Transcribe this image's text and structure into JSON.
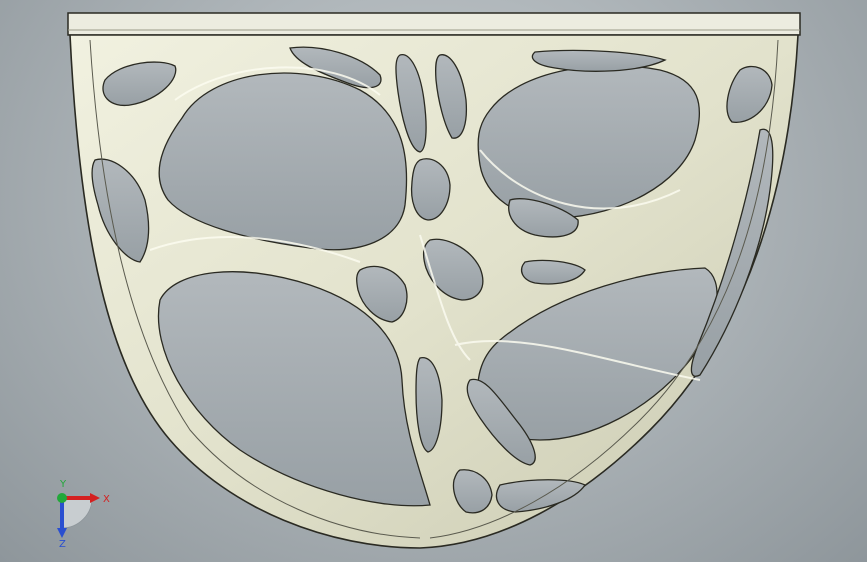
{
  "viewport": {
    "background_top": "#c4cacd",
    "background_bottom": "#8e969b"
  },
  "model": {
    "part_color": "#e4e4cf",
    "edge_color": "#2a2a22",
    "hole_color": "#a3aaae"
  },
  "triad": {
    "x_label": "X",
    "y_label": "Y",
    "z_label": "Z",
    "x_color": "#d42020",
    "y_color": "#22a83a",
    "z_color": "#2a4fd0"
  }
}
